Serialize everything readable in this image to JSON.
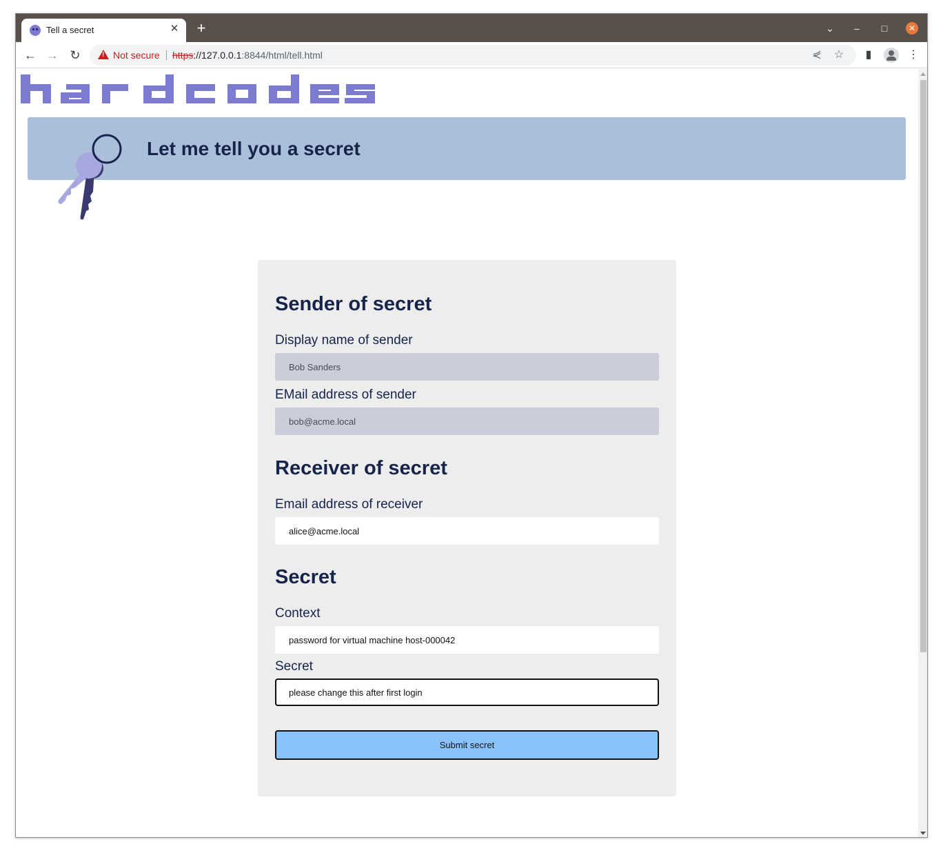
{
  "browser": {
    "tab_title": "Tell a secret",
    "url_scheme": "https",
    "url_host": "://127.0.0.1",
    "url_rest": ":8844/html/tell.html",
    "security_label": "Not secure"
  },
  "page": {
    "logo_text": "hardcodes",
    "banner_title": "Let me tell you a secret",
    "accent_color": "#7b7bd0",
    "banner_color": "#abbfdb"
  },
  "form": {
    "sender": {
      "heading": "Sender of secret",
      "name_label": "Display name of sender",
      "name_value": "Bob Sanders",
      "email_label": "EMail address of sender",
      "email_value": "bob@acme.local"
    },
    "receiver": {
      "heading": "Receiver of secret",
      "email_label": "Email address of receiver",
      "email_value": "alice@acme.local"
    },
    "secret": {
      "heading": "Secret",
      "context_label": "Context",
      "context_value": "password for virtual machine host-000042",
      "secret_label": "Secret",
      "secret_value": "please change this after first login"
    },
    "submit_label": "Submit secret",
    "submit_color": "#8ac3fb"
  }
}
